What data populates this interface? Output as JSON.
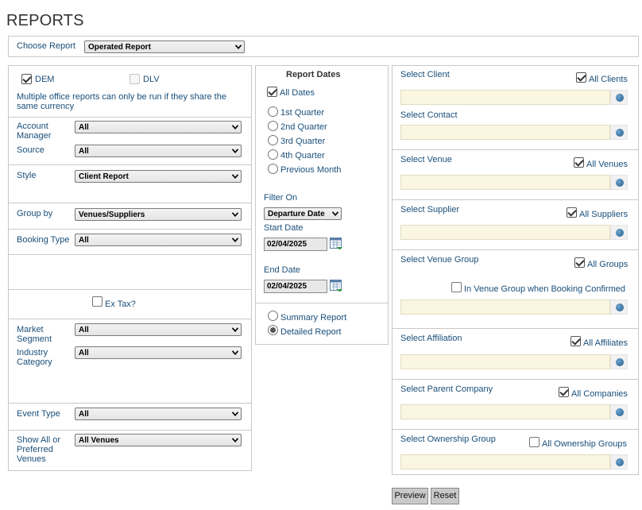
{
  "page": {
    "title": "REPORTS"
  },
  "choose_report": {
    "label": "Choose Report",
    "value": "Operated Report"
  },
  "left": {
    "offices": [
      {
        "label": "DEM",
        "checked": true,
        "disabled": false
      },
      {
        "label": "DLV",
        "checked": false,
        "disabled": true
      }
    ],
    "office_note": "Multiple office reports can only be run if they share the same currency",
    "account_manager": {
      "label": "Account Manager",
      "value": "All"
    },
    "source": {
      "label": "Source",
      "value": "All"
    },
    "style": {
      "label": "Style",
      "value": "Client Report"
    },
    "group_by": {
      "label": "Group by",
      "value": "Venues/Suppliers"
    },
    "booking_type": {
      "label": "Booking Type",
      "value": "All"
    },
    "ex_tax": {
      "label": "Ex Tax?",
      "checked": false
    },
    "market_segment": {
      "label": "Market Segment",
      "value": "All"
    },
    "industry_category": {
      "label": "Industry Category",
      "value": "All"
    },
    "event_type": {
      "label": "Event Type",
      "value": "All"
    },
    "show_venues": {
      "label": "Show All or Preferred Venues",
      "value": "All Venues"
    }
  },
  "middle": {
    "heading": "Report Dates",
    "all_dates": {
      "label": "All Dates",
      "checked": true
    },
    "quarters": [
      {
        "label": "1st Quarter",
        "selected": false
      },
      {
        "label": "2nd Quarter",
        "selected": false
      },
      {
        "label": "3rd Quarter",
        "selected": false
      },
      {
        "label": "4th Quarter",
        "selected": false
      },
      {
        "label": "Previous Month",
        "selected": false
      }
    ],
    "filter_on": {
      "label": "Filter On",
      "value": "Departure Date"
    },
    "start_date": {
      "label": "Start Date",
      "value": "02/04/2025"
    },
    "end_date": {
      "label": "End Date",
      "value": "02/04/2025"
    },
    "report_modes": [
      {
        "label": "Summary Report",
        "selected": false
      },
      {
        "label": "Detailed Report",
        "selected": true
      }
    ]
  },
  "right": {
    "client": {
      "label": "Select Client",
      "all_label": "All Clients",
      "checked": true,
      "value": ""
    },
    "contact": {
      "label": "Select Contact",
      "value": ""
    },
    "venue": {
      "label": "Select Venue",
      "all_label": "All Venues",
      "checked": true,
      "value": ""
    },
    "supplier": {
      "label": "Select Supplier",
      "all_label": "All Suppliers",
      "checked": true,
      "value": ""
    },
    "venue_group": {
      "label": "Select Venue Group",
      "all_label": "All Groups",
      "checked": true,
      "value": "",
      "in_group_label": "In Venue Group when Booking Confirmed",
      "in_group_checked": false
    },
    "affiliation": {
      "label": "Select Affiliation",
      "all_label": "All Affiliates",
      "checked": true,
      "value": ""
    },
    "parent_company": {
      "label": "Select Parent Company",
      "all_label": "All Companies",
      "checked": true,
      "value": ""
    },
    "ownership_group": {
      "label": "Select Ownership Group",
      "all_label": "All Ownership Groups",
      "checked": false,
      "value": ""
    }
  },
  "actions": {
    "preview": "Preview",
    "reset": "Reset"
  },
  "icons": {
    "lookup": "globe-icon",
    "calendar": "calendar-icon",
    "dropdown": "chevron-down-icon"
  }
}
